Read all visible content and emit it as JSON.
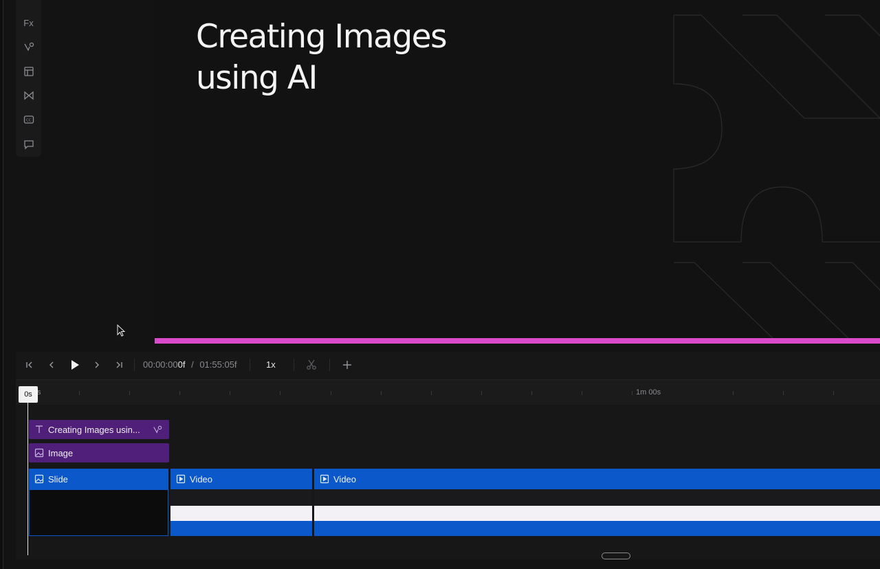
{
  "stage": {
    "title": "Creating Images using AI",
    "progress_fraction": 1.0,
    "accent_color": "#d94bc9"
  },
  "left_rail": {
    "items": [
      {
        "name": "effects",
        "label": "Fx"
      },
      {
        "name": "animation-icon"
      },
      {
        "name": "layout-icon"
      },
      {
        "name": "transition-icon"
      },
      {
        "name": "captions-icon",
        "label": "CC"
      },
      {
        "name": "comment-icon"
      }
    ]
  },
  "timeline": {
    "current_time": "00:00:00",
    "current_frame": "0f",
    "separator": "/",
    "total_time": "01:55:05f",
    "speed": "1x",
    "ruler": {
      "start_label": "s",
      "mid_label": "1m 00s"
    },
    "playhead_label": "0s",
    "tracks": {
      "text_clip": {
        "label": "Creating Images usin..."
      },
      "image_clip": {
        "label": "Image"
      },
      "slide_clip": {
        "label": "Slide"
      },
      "video_clip_1": {
        "label": "Video"
      },
      "video_clip_2": {
        "label": "Video"
      }
    }
  },
  "colors": {
    "purple_clip": "#4f1f7a",
    "blue_clip": "#0a58c9"
  }
}
